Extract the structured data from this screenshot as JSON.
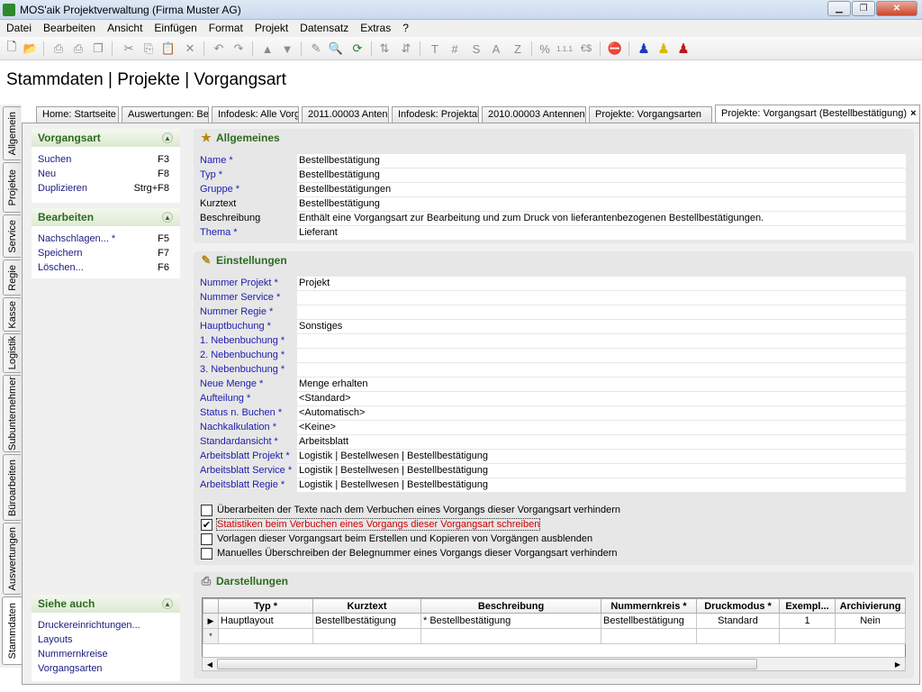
{
  "window": {
    "title": "MOS'aik Projektverwaltung (Firma Muster AG)"
  },
  "menu": [
    "Datei",
    "Bearbeiten",
    "Ansicht",
    "Einfügen",
    "Format",
    "Projekt",
    "Datensatz",
    "Extras",
    "?"
  ],
  "toolbar_text": {
    "t": "T",
    "hash": "#",
    "s": "S",
    "a": "A",
    "z": "Z",
    "pct": "%",
    "euro": "€$"
  },
  "page_title": "Stammdaten | Projekte | Vorgangsart",
  "side_tabs": [
    "Allgemein",
    "Projekte",
    "Service",
    "Regie",
    "Kasse",
    "Logistik",
    "Subunternehmer",
    "Büroarbeiten",
    "Auswertungen",
    "Stammdaten"
  ],
  "tabs": [
    {
      "label": "Home: Startseite"
    },
    {
      "label": "Auswertungen: Be"
    },
    {
      "label": "Infodesk: Alle Vorg"
    },
    {
      "label": "2011.00003 Anten"
    },
    {
      "label": "Infodesk: Projektal"
    },
    {
      "label": "2010.00003 Antennen"
    },
    {
      "label": "Projekte: Vorgangsarten"
    },
    {
      "label": "Projekte: Vorgangsart (Bestellbestätigung)"
    }
  ],
  "tab_close": "×",
  "left_panels": {
    "vorgangsart": {
      "title": "Vorgangsart",
      "items": [
        {
          "label": "Suchen",
          "key": "F3"
        },
        {
          "label": "Neu",
          "key": "F8"
        },
        {
          "label": "Duplizieren",
          "key": "Strg+F8"
        }
      ]
    },
    "bearbeiten": {
      "title": "Bearbeiten",
      "items": [
        {
          "label": "Nachschlagen... *",
          "key": "F5"
        },
        {
          "label": "Speichern",
          "key": "F7"
        },
        {
          "label": "Löschen...",
          "key": "F6"
        }
      ]
    },
    "siehe_auch": {
      "title": "Siehe auch",
      "items": [
        {
          "label": "Druckereinrichtungen..."
        },
        {
          "label": "Layouts"
        },
        {
          "label": "Nummernkreise"
        },
        {
          "label": "Vorgangsarten"
        }
      ]
    }
  },
  "allgemeines": {
    "title": "Allgemeines",
    "fields": [
      {
        "label": "Name *",
        "value": "Bestellbestätigung"
      },
      {
        "label": "Typ *",
        "value": "Bestellbestätigung"
      },
      {
        "label": "Gruppe *",
        "value": "Bestellbestätigungen"
      },
      {
        "label": "Kurztext",
        "value": "Bestellbestätigung"
      },
      {
        "label": "Beschreibung",
        "value": "Enthält eine Vorgangsart zur Bearbeitung und zum Druck von lieferantenbezogenen Bestellbestätigungen."
      },
      {
        "label": "Thema *",
        "value": "Lieferant"
      }
    ]
  },
  "einstellungen": {
    "title": "Einstellungen",
    "fields": [
      {
        "label": "Nummer Projekt *",
        "value": "Projekt"
      },
      {
        "label": "Nummer Service *",
        "value": ""
      },
      {
        "label": "Nummer Regie *",
        "value": ""
      },
      {
        "label": "Hauptbuchung *",
        "value": "Sonstiges"
      },
      {
        "label": "1. Nebenbuchung *",
        "value": ""
      },
      {
        "label": "2. Nebenbuchung *",
        "value": ""
      },
      {
        "label": "3. Nebenbuchung *",
        "value": ""
      },
      {
        "label": "Neue Menge *",
        "value": "Menge erhalten"
      },
      {
        "label": "Aufteilung *",
        "value": "<Standard>"
      },
      {
        "label": "Status n. Buchen *",
        "value": "<Automatisch>"
      },
      {
        "label": "Nachkalkulation *",
        "value": "<Keine>"
      },
      {
        "label": "Standardansicht *",
        "value": "Arbeitsblatt"
      },
      {
        "label": "Arbeitsblatt Projekt *",
        "value": "Logistik | Bestellwesen | Bestellbestätigung"
      },
      {
        "label": "Arbeitsblatt Service *",
        "value": "Logistik | Bestellwesen | Bestellbestätigung"
      },
      {
        "label": "Arbeitsblatt Regie *",
        "value": "Logistik | Bestellwesen | Bestellbestätigung"
      }
    ],
    "checkboxes": [
      {
        "label": "Überarbeiten der Texte nach dem Verbuchen eines Vorgangs dieser Vorgangsart verhindern",
        "checked": false
      },
      {
        "label": "Statistiken beim Verbuchen eines Vorgangs dieser Vorgangsart schreiben",
        "checked": true
      },
      {
        "label": "Vorlagen dieser Vorgangsart beim Erstellen und Kopieren von Vorgängen ausblenden",
        "checked": false
      },
      {
        "label": "Manuelles Überschreiben der Belegnummer eines Vorgangs dieser Vorgangsart verhindern",
        "checked": false
      }
    ]
  },
  "darstellungen": {
    "title": "Darstellungen",
    "columns": [
      "Typ *",
      "Kurztext",
      "Beschreibung",
      "Nummernkreis *",
      "Druckmodus *",
      "Exempl...",
      "Archivierung"
    ],
    "rows": [
      {
        "marker": "▶",
        "cells": [
          "Hauptlayout",
          "Bestellbestätigung",
          "* Bestellbestätigung",
          "Bestellbestätigung",
          "Standard",
          "1",
          "Nein"
        ]
      }
    ],
    "new_row_marker": "*"
  }
}
